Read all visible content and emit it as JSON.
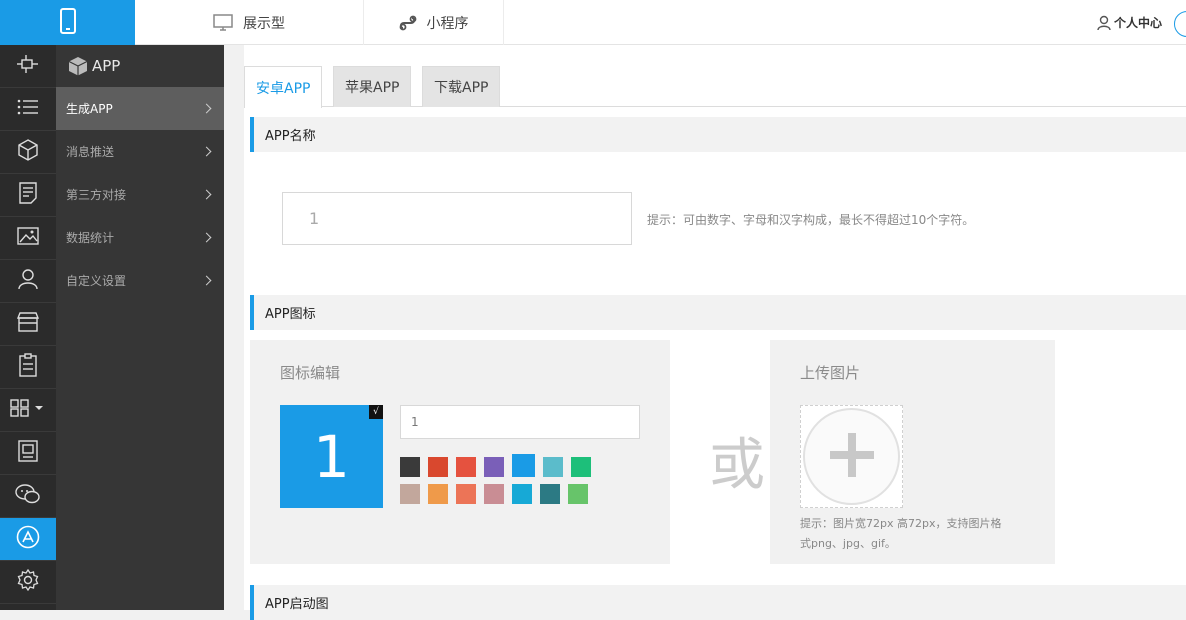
{
  "topnav": {
    "tabs": [
      {
        "label": "展示型",
        "icon": "monitor-icon"
      },
      {
        "label": "小程序",
        "icon": "miniprogram-icon"
      }
    ],
    "user_label": "个人中心",
    "logo_icon": "phone-icon"
  },
  "iconbar": {
    "icons": [
      "plugin-icon",
      "list-icon",
      "box-icon",
      "document-icon",
      "image-icon",
      "user-icon",
      "store-icon",
      "clipboard-icon",
      "grid-icon",
      "book-icon",
      "wechat-icon",
      "app-store-icon",
      "settings-icon"
    ],
    "active_index": 11
  },
  "submenu": {
    "header": "APP",
    "items": [
      {
        "label": "生成APP",
        "active": true
      },
      {
        "label": "消息推送",
        "active": false
      },
      {
        "label": "第三方对接",
        "active": false
      },
      {
        "label": "数据统计",
        "active": false
      },
      {
        "label": "自定义设置",
        "active": false
      }
    ]
  },
  "tabs": [
    {
      "label": "安卓APP",
      "active": true
    },
    {
      "label": "苹果APP",
      "active": false
    },
    {
      "label": "下载APP",
      "active": false
    }
  ],
  "name_section": {
    "title": "APP名称",
    "input_value": "1",
    "hint": "提示：可由数字、字母和汉字构成，最长不得超过10个字符。"
  },
  "icon_section": {
    "title": "APP图标",
    "editor_title": "图标编辑",
    "preview_text": "1",
    "check_mark": "√",
    "text_input_value": "1",
    "or_text": "或",
    "upload_title": "上传图片",
    "upload_hint_1": "提示：图片宽72px 高72px，支持图片格",
    "upload_hint_2": "式png、jpg、gif。",
    "selected_color": "#1a9be6",
    "colors": [
      "#3a3a3a",
      "#d9482e",
      "#e5523f",
      "#7a5fb8",
      "#1a9be6",
      "#5bbccb",
      "#1dbf7a",
      "#c2a79c",
      "#ef9a4a",
      "#ec7457",
      "#c98d94",
      "#17a9d6",
      "#2c7a84",
      "#67c46a"
    ]
  },
  "splash_section": {
    "title": "APP启动图"
  }
}
